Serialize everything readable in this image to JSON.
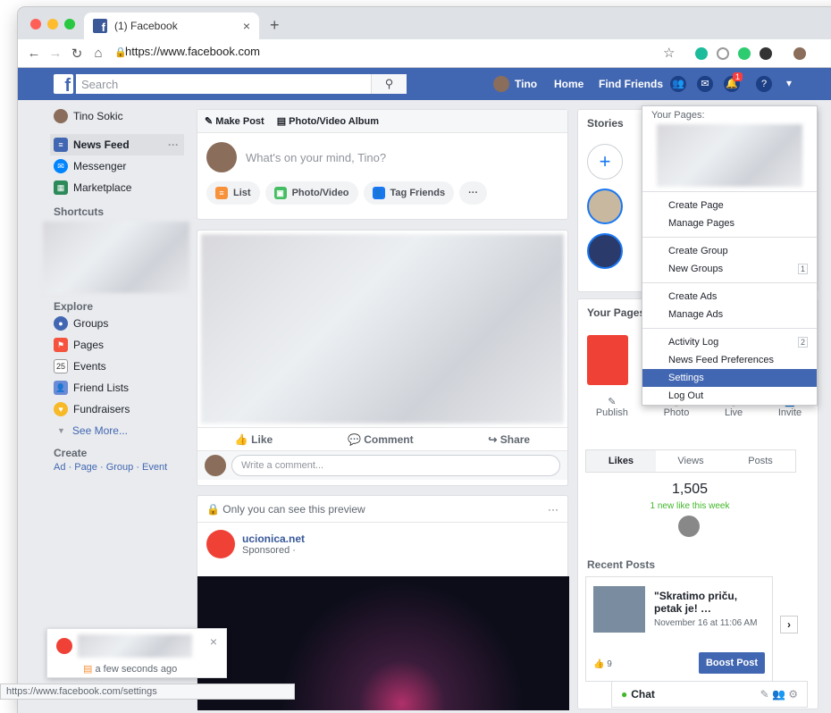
{
  "browser": {
    "tab_title": "(1) Facebook",
    "url": "https://www.facebook.com"
  },
  "fb": {
    "search_placeholder": "Search",
    "user_name": "Tino",
    "nav_home": "Home",
    "nav_find_friends": "Find Friends",
    "notif_count": "1"
  },
  "left": {
    "profile": "Tino Sokic",
    "news_feed": "News Feed",
    "messenger": "Messenger",
    "marketplace": "Marketplace",
    "shortcuts": "Shortcuts",
    "explore": "Explore",
    "groups": "Groups",
    "pages": "Pages",
    "events": "Events",
    "events_day": "25",
    "friend_lists": "Friend Lists",
    "fundraisers": "Fundraisers",
    "see_more": "See More...",
    "create": "Create",
    "create_links": "Ad · Page · Group · Event"
  },
  "composer": {
    "make_post": "Make Post",
    "photo_album": "Photo/Video Album",
    "prompt": "What's on your mind, Tino?",
    "list": "List",
    "photo": "Photo/Video",
    "tag": "Tag Friends",
    "more": "···"
  },
  "post": {
    "like": "Like",
    "comment": "Comment",
    "share": "Share",
    "comment_placeholder": "Write a comment..."
  },
  "ad": {
    "preview": "Only you can see this preview",
    "name": "ucionica.net",
    "sponsored": "Sponsored ·"
  },
  "right": {
    "stories": "Stories",
    "your_pages": "Your Pages",
    "publish": "Publish",
    "photo": "Photo",
    "live": "Live",
    "invite": "Invite",
    "tabs": [
      "Likes",
      "Views",
      "Posts"
    ],
    "likes_count": "1,505",
    "likes_week": "1 new like this week",
    "recent_posts": "Recent Posts",
    "post_title": "\"Skratimo priču, petak je! …",
    "post_date": "November 16 at 11:06 AM",
    "reactions": "9",
    "boost": "Boost Post"
  },
  "menu": {
    "your_pages": "Your Pages:",
    "items": [
      {
        "label": "Create Page"
      },
      {
        "label": "Manage Pages"
      },
      {
        "label": "Create Group"
      },
      {
        "label": "New Groups",
        "badge": "1"
      },
      {
        "label": "Create Ads"
      },
      {
        "label": "Manage Ads"
      },
      {
        "label": "Activity Log",
        "badge": "2"
      },
      {
        "label": "News Feed Preferences"
      },
      {
        "label": "Settings"
      },
      {
        "label": "Log Out"
      }
    ]
  },
  "toast": {
    "time": "a few seconds ago"
  },
  "chat": {
    "label": "Chat"
  },
  "status_url": "https://www.facebook.com/settings"
}
